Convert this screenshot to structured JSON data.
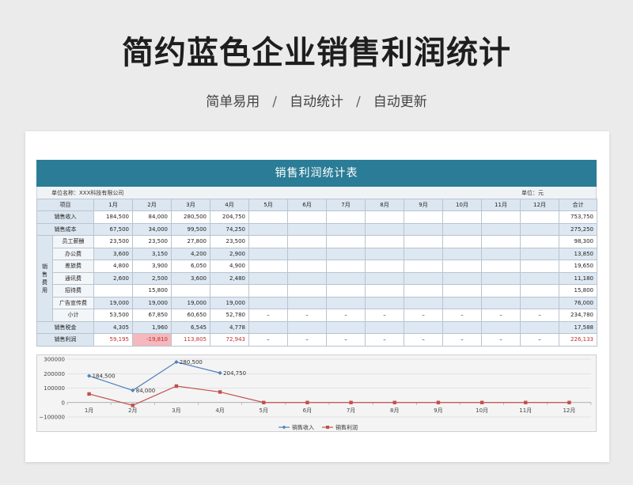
{
  "page": {
    "title": "简约蓝色企业销售利润统计",
    "subtitle": [
      "简单易用",
      "/",
      "自动统计",
      "/",
      "自动更新"
    ]
  },
  "sheet": {
    "banner": "销售利润统计表",
    "unit_name": "单位名称：XXX科技有限公司",
    "unit": "单位：元",
    "header": [
      "项目",
      "1月",
      "2月",
      "3月",
      "4月",
      "5月",
      "6月",
      "7月",
      "8月",
      "9月",
      "10月",
      "11月",
      "12月",
      "合计"
    ],
    "group_label": [
      "销",
      "售",
      "费",
      "用"
    ],
    "rows": [
      {
        "label": "销售收入",
        "values": [
          "184,500",
          "84,000",
          "280,500",
          "204,750",
          "",
          "",
          "",
          "",
          "",
          "",
          "",
          ""
        ],
        "total": "753,750"
      },
      {
        "label": "销售成本",
        "values": [
          "67,500",
          "34,000",
          "99,500",
          "74,250",
          "",
          "",
          "",
          "",
          "",
          "",
          "",
          ""
        ],
        "total": "275,250"
      },
      {
        "label": "员工薪酬",
        "values": [
          "23,500",
          "23,500",
          "27,800",
          "23,500",
          "",
          "",
          "",
          "",
          "",
          "",
          "",
          ""
        ],
        "total": "98,300"
      },
      {
        "label": "办公费",
        "values": [
          "3,600",
          "3,150",
          "4,200",
          "2,900",
          "",
          "",
          "",
          "",
          "",
          "",
          "",
          ""
        ],
        "total": "13,850"
      },
      {
        "label": "差旅费",
        "values": [
          "4,800",
          "3,900",
          "6,050",
          "4,900",
          "",
          "",
          "",
          "",
          "",
          "",
          "",
          ""
        ],
        "total": "19,650"
      },
      {
        "label": "通讯费",
        "values": [
          "2,600",
          "2,500",
          "3,600",
          "2,480",
          "",
          "",
          "",
          "",
          "",
          "",
          "",
          ""
        ],
        "total": "11,180"
      },
      {
        "label": "招待费",
        "values": [
          "",
          "15,800",
          "",
          "",
          "",
          "",
          "",
          "",
          "",
          "",
          "",
          ""
        ],
        "total": "15,800"
      },
      {
        "label": "广告宣传费",
        "values": [
          "19,000",
          "19,000",
          "19,000",
          "19,000",
          "",
          "",
          "",
          "",
          "",
          "",
          "",
          ""
        ],
        "total": "76,000"
      },
      {
        "label": "小计",
        "values": [
          "53,500",
          "67,850",
          "60,650",
          "52,780",
          "–",
          "–",
          "–",
          "–",
          "–",
          "–",
          "–",
          "–"
        ],
        "total": "234,780"
      },
      {
        "label": "销售税金",
        "values": [
          "4,305",
          "1,960",
          "6,545",
          "4,778",
          "",
          "",
          "",
          "",
          "",
          "",
          "",
          ""
        ],
        "total": "17,588"
      },
      {
        "label": "销售利润",
        "values": [
          "59,195",
          "-19,810",
          "113,805",
          "72,943",
          "–",
          "–",
          "–",
          "–",
          "–",
          "–",
          "–",
          "–"
        ],
        "total": "226,133"
      }
    ]
  },
  "chart_data": {
    "type": "line",
    "categories": [
      "1月",
      "2月",
      "3月",
      "4月",
      "5月",
      "6月",
      "7月",
      "8月",
      "9月",
      "10月",
      "11月",
      "12月"
    ],
    "series": [
      {
        "name": "销售收入",
        "values": [
          184500,
          84000,
          280500,
          204750,
          null,
          null,
          null,
          null,
          null,
          null,
          null,
          null
        ],
        "labels": [
          "184,500",
          "84,000",
          "280,500",
          "204,750"
        ],
        "color": "#4f81bd"
      },
      {
        "name": "销售利润",
        "values": [
          59195,
          -19810,
          113805,
          72943,
          0,
          0,
          0,
          0,
          0,
          0,
          0,
          0
        ],
        "color": "#c0504d"
      }
    ],
    "yticks": [
      "300000",
      "200000",
      "100000",
      "0",
      "−100000"
    ],
    "ylim": [
      -100000,
      300000
    ],
    "grid": true,
    "legend": "bottom"
  }
}
